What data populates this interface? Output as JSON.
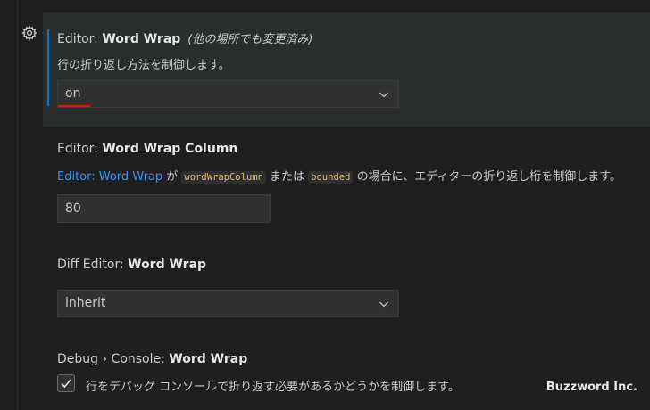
{
  "settings": [
    {
      "category": "Editor: ",
      "name": "Word Wrap",
      "modified_note": "(他の場所でも変更済み)",
      "description": "行の折り返し方法を制御します。",
      "value": "on"
    },
    {
      "category": "Editor: ",
      "name": "Word Wrap Column",
      "desc_link": "Editor: Word Wrap",
      "desc_part1": " が ",
      "desc_code1": "wordWrapColumn",
      "desc_part2": " または ",
      "desc_code2": "bounded",
      "desc_part3": " の場合に、エディターの折り返し桁を制御します。",
      "value": "80"
    },
    {
      "category": "Diff Editor: ",
      "name": "Word Wrap",
      "value": "inherit"
    },
    {
      "category": "Debug › Console: ",
      "name": "Word Wrap",
      "description": "行をデバッグ コンソールで折り返す必要があるかどうかを制御します。",
      "checked": true
    }
  ],
  "watermark": "Buzzword Inc.",
  "colors": {
    "background": "#1f1f1f",
    "focus_bar": "#0078d4",
    "link": "#3794ff",
    "error_underline": "#e51400"
  },
  "icons": [
    "gear-icon",
    "chevron-down-icon",
    "checkmark-icon"
  ]
}
